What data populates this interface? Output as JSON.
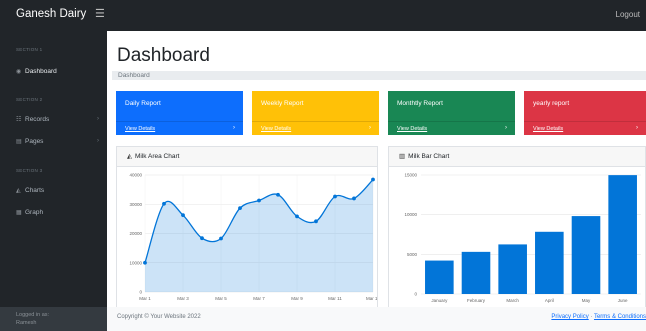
{
  "topbar": {
    "brand": "Ganesh Dairy",
    "toggle_icon": "☰",
    "logout": "Logout"
  },
  "sidebar": {
    "sections": [
      "SECTION 1",
      "SECTION 2",
      "SECTION 3"
    ],
    "items": [
      {
        "label": "Dashboard",
        "icon": "dashboard-icon",
        "glyph": "◉"
      },
      {
        "label": "Records",
        "icon": "columns-icon",
        "glyph": "☷",
        "chevron": "›"
      },
      {
        "label": "Pages",
        "icon": "book-icon",
        "glyph": "▤",
        "chevron": "›"
      },
      {
        "label": "Charts",
        "icon": "area-chart-icon",
        "glyph": "◭"
      },
      {
        "label": "Graph",
        "icon": "table-icon",
        "glyph": "▦"
      }
    ],
    "footer": {
      "line1": "Logged in as:",
      "line2": "Ramesh"
    }
  },
  "main": {
    "title": "Dashboard",
    "breadcrumb": "Dashboard"
  },
  "cards": [
    {
      "title": "Daily Report",
      "link": "View Details",
      "chevron": "›",
      "color": "#0d6efd"
    },
    {
      "title": "Weekly Report",
      "link": "View Details",
      "chevron": "›",
      "color": "#ffc107"
    },
    {
      "title": "Monthtly Report",
      "link": "View Details",
      "chevron": "›",
      "color": "#198754"
    },
    {
      "title": "yearly report",
      "link": "View Details",
      "chevron": "›",
      "color": "#dc3545"
    }
  ],
  "panels": {
    "area": {
      "title": "Milk Area Chart",
      "icon": "area-chart-icon",
      "glyph": "◭"
    },
    "bar": {
      "title": "Milk Bar Chart",
      "icon": "bar-chart-icon",
      "glyph": "▥"
    }
  },
  "footer": {
    "copyright": "Copyright © Your Website 2022",
    "privacy": "Privacy Policy",
    "sep": " · ",
    "terms": "Terms & Conditions"
  },
  "chart_data": [
    {
      "type": "area",
      "title": "Milk Area Chart",
      "categories": [
        "Mar 1",
        "Mar 3",
        "Mar 5",
        "Mar 7",
        "Mar 9",
        "Mar 11",
        "Mar 13"
      ],
      "x": [
        "Mar 1",
        "Mar 2",
        "Mar 3",
        "Mar 4",
        "Mar 5",
        "Mar 6",
        "Mar 7",
        "Mar 8",
        "Mar 9",
        "Mar 10",
        "Mar 11",
        "Mar 12",
        "Mar 13"
      ],
      "values": [
        10000,
        30162,
        26263,
        18394,
        18287,
        28682,
        31274,
        33259,
        25849,
        24159,
        32651,
        31984,
        38451
      ],
      "ylim": [
        0,
        40000
      ],
      "yticks": [
        0,
        10000,
        20000,
        30000,
        40000
      ],
      "grid": true,
      "color": "#0275d8"
    },
    {
      "type": "bar",
      "title": "Milk Bar Chart",
      "categories": [
        "January",
        "February",
        "March",
        "April",
        "May",
        "June"
      ],
      "values": [
        4215,
        5312,
        6251,
        7841,
        9821,
        14984
      ],
      "ylim": [
        0,
        15000
      ],
      "yticks": [
        0,
        5000,
        10000,
        15000
      ],
      "grid": true,
      "color": "#0275d8"
    }
  ]
}
